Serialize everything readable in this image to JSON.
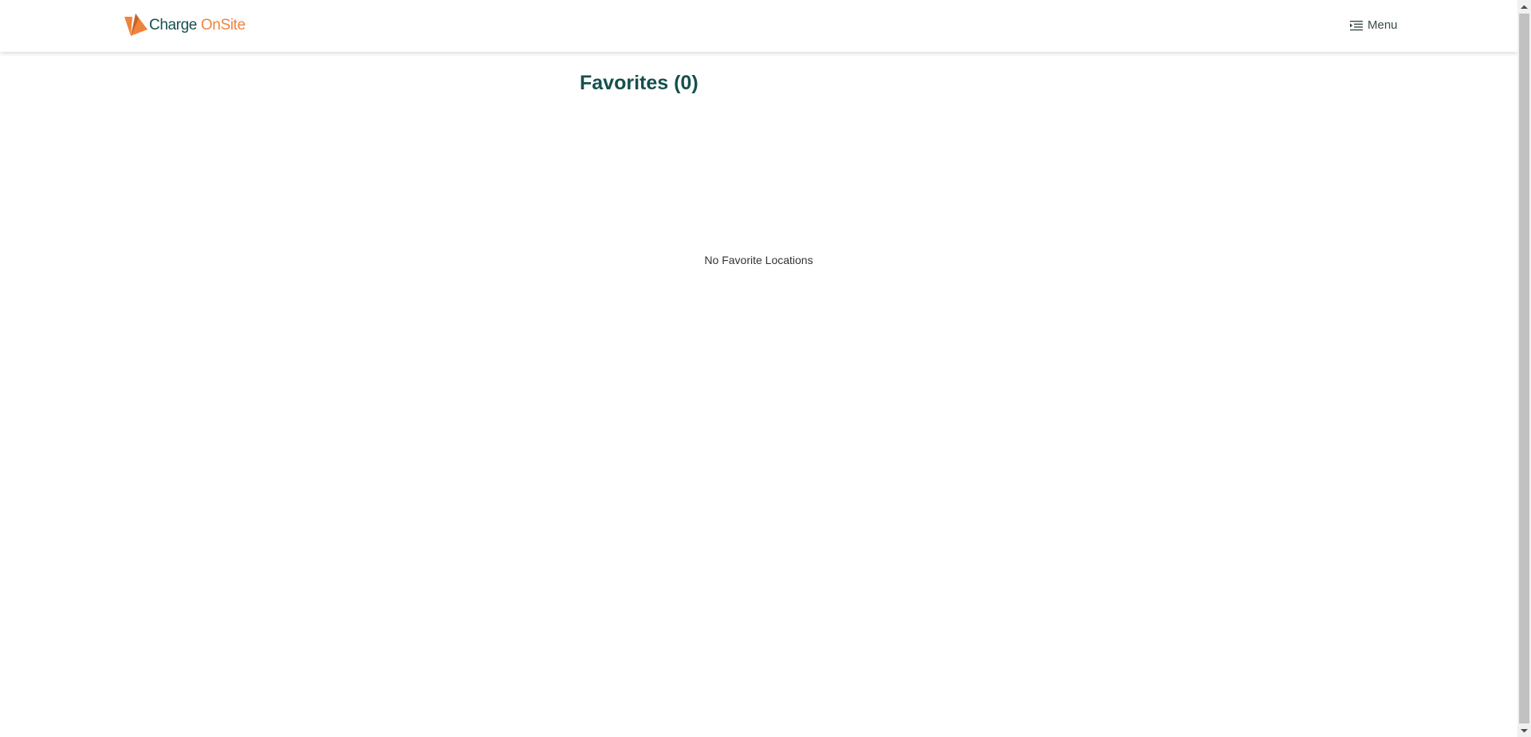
{
  "header": {
    "logo": {
      "word1": "Charge",
      "word2": "OnSite",
      "icon": "charge-onsite-logo-icon"
    },
    "menu": {
      "label": "Menu",
      "icon": "menu-list-icon"
    }
  },
  "main": {
    "title": "Favorites (0)",
    "empty_message": "No Favorite Locations"
  },
  "colors": {
    "brand_green": "#16504c",
    "brand_orange": "#f0833c",
    "text_dark": "#333333"
  }
}
